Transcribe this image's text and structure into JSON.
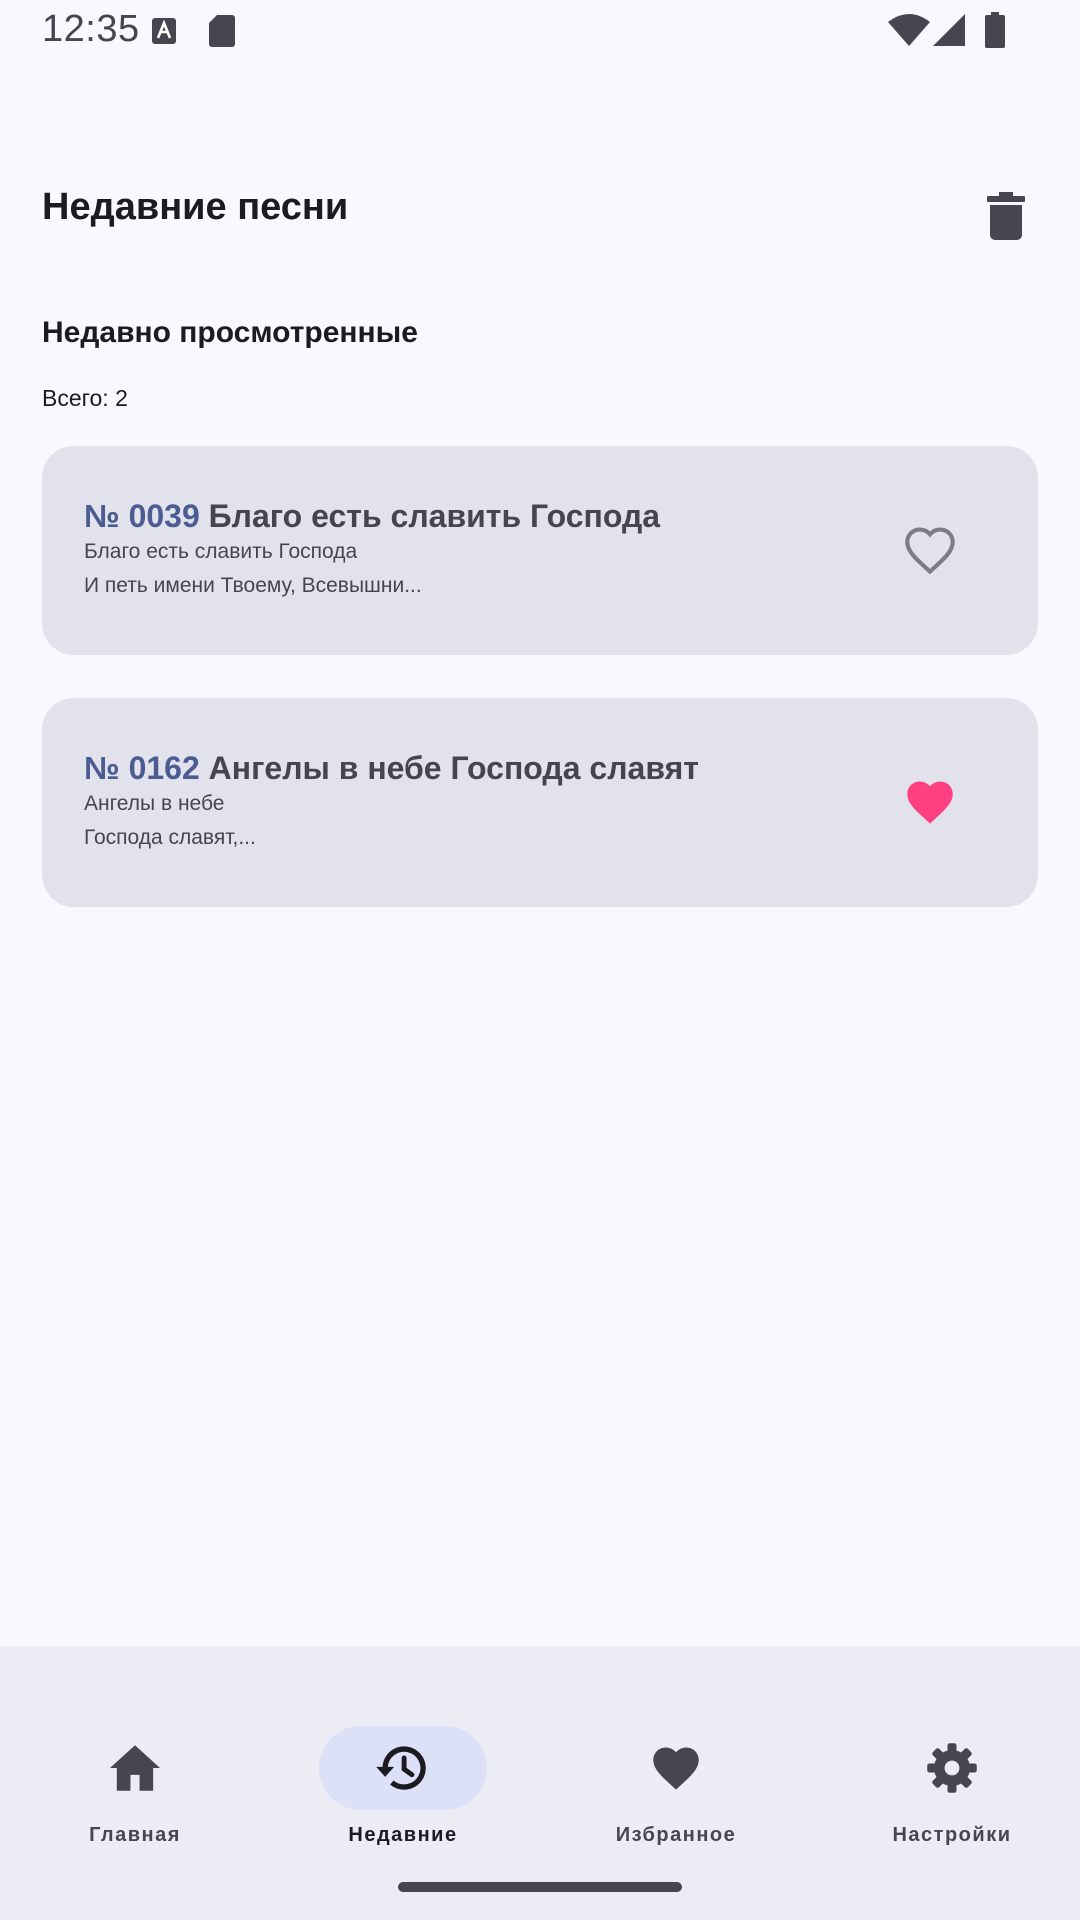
{
  "status_bar": {
    "time": "12:35"
  },
  "header": {
    "title": "Недавние песни"
  },
  "section": {
    "title": "Недавно просмотренные",
    "total": "Всего: 2"
  },
  "songs": [
    {
      "number": "№ 0039",
      "title": "Благо есть славить Господа",
      "line1": "Благо есть славить Господа",
      "line2": "И петь имени Твоему, Всевышни...",
      "favorite": false
    },
    {
      "number": "№ 0162",
      "title": "Ангелы в небе Господа славят",
      "line1": "Ангелы в небе",
      "line2": "Господа славят,...",
      "favorite": true
    }
  ],
  "nav": [
    {
      "label": "Главная",
      "icon": "home-icon",
      "active": false
    },
    {
      "label": "Недавние",
      "icon": "history-icon",
      "active": true
    },
    {
      "label": "Избранное",
      "icon": "heart-icon",
      "active": false
    },
    {
      "label": "Настройки",
      "icon": "gear-icon",
      "active": false
    }
  ],
  "colors": {
    "accent": "#4B5C92",
    "favorite": "#FF4081",
    "card": "#E2E2EC",
    "background": "#F8F8FF"
  }
}
